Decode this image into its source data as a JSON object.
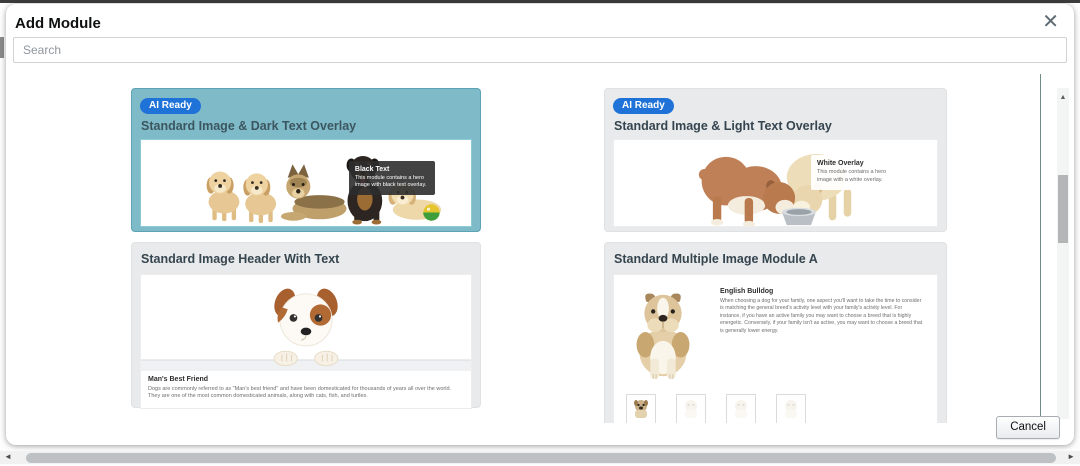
{
  "modal": {
    "title": "Add Module",
    "search_placeholder": "Search",
    "cancel_label": "Cancel"
  },
  "icons": {
    "close": "✕",
    "scroll_up": "▲",
    "scroll_left": "◄",
    "scroll_right": "►"
  },
  "cards": {
    "dark_overlay": {
      "badge": "AI Ready",
      "title": "Standard Image & Dark Text Overlay",
      "overlay_title": "Black Text",
      "overlay_body": "This module contains a hero image with black text overlay."
    },
    "light_overlay": {
      "badge": "AI Ready",
      "title": "Standard Image & Light Text Overlay",
      "overlay_title": "White Overlay",
      "overlay_body": "This module contains a hero image with a white overlay."
    },
    "image_header": {
      "title": "Standard Image Header With Text",
      "heading": "Man's Best Friend",
      "body": "Dogs are commonly referred to as \"Man's best friend\" and have been domesticated for thousands of years all over the world. They are one of the most common domesticated animals, along with cats, fish, and turtles."
    },
    "multiple_image": {
      "title": "Standard Multiple Image Module A",
      "heading": "English Bulldog",
      "body": "When choosing a dog for your family, one aspect you'll want to take the time to consider is matching the general breed's activity level with your family's activity level. For instance, if you have an active family you may want to choose a breed that is highly energetic. Conversely, if your family isn't as active, you may want to choose a breed that is generally lower energy."
    }
  },
  "colors": {
    "teal_card": "#7fbac8",
    "gray_card": "#e9eaeb",
    "badge_blue": "#1f72d8",
    "card_title_text": "#35454f",
    "dark_overlay_bg": "#2e2e2e"
  }
}
